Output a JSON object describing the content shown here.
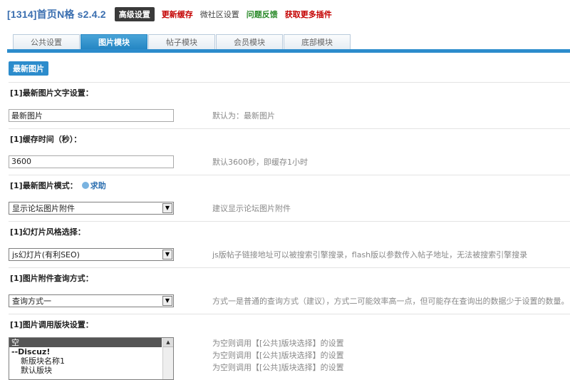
{
  "header": {
    "title": "[1314]首页N格 s2.4.2",
    "buttons": [
      {
        "label": "高级设置"
      },
      {
        "label": "更新缓存"
      },
      {
        "label": "微社区设置"
      },
      {
        "label": "问题反馈"
      },
      {
        "label": "获取更多插件"
      }
    ]
  },
  "tabs": [
    {
      "label": "公共设置"
    },
    {
      "label": "图片模块"
    },
    {
      "label": "帖子模块"
    },
    {
      "label": "会员模块"
    },
    {
      "label": "底部模块"
    }
  ],
  "section_label": "最新图片",
  "settings": {
    "text": {
      "heading": "[1]最新图片文字设置：",
      "value": "最新图片",
      "hint": "默认为：最新图片"
    },
    "cache": {
      "heading": "[1]缓存时间（秒）：",
      "value": "3600",
      "hint": "默认3600秒，即缓存1小时"
    },
    "mode": {
      "heading": "[1]最新图片模式：",
      "help": "求助",
      "selected": "显示论坛图片附件",
      "hint": "建议显示论坛图片附件"
    },
    "slide": {
      "heading": "[1]幻灯片风格选择：",
      "selected": "js幻灯片(有利SEO)",
      "hint": "js版帖子链接地址可以被搜索引擎搜录，flash版以参数传入帖子地址，无法被搜索引擎搜录"
    },
    "query": {
      "heading": "[1]图片附件查询方式：",
      "selected": "查询方式一",
      "hint": "方式一是普通的查询方式（建议），方式二可能效率高一点，但可能存在查询出的数据少于设置的数量。"
    },
    "block": {
      "heading": "[1]图片调用版块设置：",
      "options": [
        "空",
        "--Discuz!",
        "新版块名称1",
        "默认版块"
      ],
      "hints": [
        "为空则调用【[公共]版块选择】的设置",
        "为空则调用【[公共]版块选择】的设置",
        "为空则调用【[公共]版块选择】的设置"
      ]
    }
  }
}
